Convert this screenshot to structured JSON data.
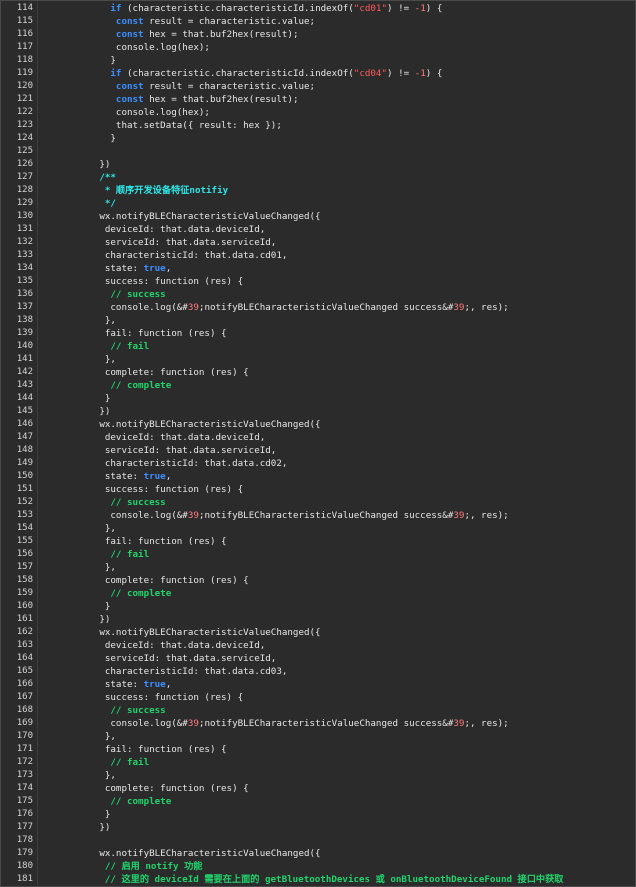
{
  "editor": {
    "lines": [
      {
        "n": "114",
        "t": [
          [
            "            ",
            ""
          ],
          [
            "if",
            "kw"
          ],
          [
            " (characteristic.characteristicId.indexOf(",
            ""
          ],
          [
            "\"cd01\"",
            "str"
          ],
          [
            ") != ",
            ""
          ],
          [
            "-1",
            "num"
          ],
          [
            ") {",
            ""
          ]
        ]
      },
      {
        "n": "115",
        "t": [
          [
            "             ",
            ""
          ],
          [
            "const",
            "kw"
          ],
          [
            " result = characteristic.value;",
            ""
          ]
        ]
      },
      {
        "n": "116",
        "t": [
          [
            "             ",
            ""
          ],
          [
            "const",
            "kw"
          ],
          [
            " hex = that.buf2hex(result);",
            ""
          ]
        ]
      },
      {
        "n": "117",
        "t": [
          [
            "             console.log(hex);",
            ""
          ]
        ]
      },
      {
        "n": "118",
        "t": [
          [
            "            }",
            ""
          ]
        ]
      },
      {
        "n": "119",
        "t": [
          [
            "            ",
            ""
          ],
          [
            "if",
            "kw"
          ],
          [
            " (characteristic.characteristicId.indexOf(",
            ""
          ],
          [
            "\"cd04\"",
            "str"
          ],
          [
            ") != ",
            ""
          ],
          [
            "-1",
            "num"
          ],
          [
            ") {",
            ""
          ]
        ]
      },
      {
        "n": "120",
        "t": [
          [
            "             ",
            ""
          ],
          [
            "const",
            "kw"
          ],
          [
            " result = characteristic.value;",
            ""
          ]
        ]
      },
      {
        "n": "121",
        "t": [
          [
            "             ",
            ""
          ],
          [
            "const",
            "kw"
          ],
          [
            " hex = that.buf2hex(result);",
            ""
          ]
        ]
      },
      {
        "n": "122",
        "t": [
          [
            "             console.log(hex);",
            ""
          ]
        ]
      },
      {
        "n": "123",
        "t": [
          [
            "             that.setData({ result: hex });",
            ""
          ]
        ]
      },
      {
        "n": "124",
        "t": [
          [
            "            }",
            ""
          ]
        ]
      },
      {
        "n": "125",
        "t": [
          [
            "",
            ""
          ]
        ]
      },
      {
        "n": "126",
        "t": [
          [
            "          })",
            ""
          ]
        ]
      },
      {
        "n": "127",
        "t": [
          [
            "          /**",
            "doc"
          ]
        ]
      },
      {
        "n": "128",
        "t": [
          [
            "           * 顺序开发设备特征notifiy",
            "doc"
          ]
        ]
      },
      {
        "n": "129",
        "t": [
          [
            "           */",
            "doc"
          ]
        ]
      },
      {
        "n": "130",
        "t": [
          [
            "          wx.notifyBLECharacteristicValueChanged({",
            ""
          ]
        ]
      },
      {
        "n": "131",
        "t": [
          [
            "           deviceId: that.data.deviceId,",
            ""
          ]
        ]
      },
      {
        "n": "132",
        "t": [
          [
            "           serviceId: that.data.serviceId,",
            ""
          ]
        ]
      },
      {
        "n": "133",
        "t": [
          [
            "           characteristicId: that.data.cd01,",
            ""
          ]
        ]
      },
      {
        "n": "134",
        "t": [
          [
            "           state: ",
            ""
          ],
          [
            "true",
            "kw"
          ],
          [
            ",",
            ""
          ]
        ]
      },
      {
        "n": "135",
        "t": [
          [
            "           success: function (res) {",
            ""
          ]
        ]
      },
      {
        "n": "136",
        "t": [
          [
            "            // success",
            "cm"
          ]
        ]
      },
      {
        "n": "137",
        "t": [
          [
            "            console.log(&#",
            ""
          ],
          [
            "39",
            "num"
          ],
          [
            ";notifyBLECharacteristicValueChanged success&#",
            ""
          ],
          [
            "39",
            "num"
          ],
          [
            ";, res);",
            ""
          ]
        ]
      },
      {
        "n": "138",
        "t": [
          [
            "           },",
            ""
          ]
        ]
      },
      {
        "n": "139",
        "t": [
          [
            "           fail: function (res) {",
            ""
          ]
        ]
      },
      {
        "n": "140",
        "t": [
          [
            "            // fail",
            "cm"
          ]
        ]
      },
      {
        "n": "141",
        "t": [
          [
            "           },",
            ""
          ]
        ]
      },
      {
        "n": "142",
        "t": [
          [
            "           complete: function (res) {",
            ""
          ]
        ]
      },
      {
        "n": "143",
        "t": [
          [
            "            // complete",
            "cm"
          ]
        ]
      },
      {
        "n": "144",
        "t": [
          [
            "           }",
            ""
          ]
        ]
      },
      {
        "n": "145",
        "t": [
          [
            "          })",
            ""
          ]
        ]
      },
      {
        "n": "146",
        "t": [
          [
            "          wx.notifyBLECharacteristicValueChanged({",
            ""
          ]
        ]
      },
      {
        "n": "147",
        "t": [
          [
            "           deviceId: that.data.deviceId,",
            ""
          ]
        ]
      },
      {
        "n": "148",
        "t": [
          [
            "           serviceId: that.data.serviceId,",
            ""
          ]
        ]
      },
      {
        "n": "149",
        "t": [
          [
            "           characteristicId: that.data.cd02,",
            ""
          ]
        ]
      },
      {
        "n": "150",
        "t": [
          [
            "           state: ",
            ""
          ],
          [
            "true",
            "kw"
          ],
          [
            ",",
            ""
          ]
        ]
      },
      {
        "n": "151",
        "t": [
          [
            "           success: function (res) {",
            ""
          ]
        ]
      },
      {
        "n": "152",
        "t": [
          [
            "            // success",
            "cm"
          ]
        ]
      },
      {
        "n": "153",
        "t": [
          [
            "            console.log(&#",
            ""
          ],
          [
            "39",
            "num"
          ],
          [
            ";notifyBLECharacteristicValueChanged success&#",
            ""
          ],
          [
            "39",
            "num"
          ],
          [
            ";, res);",
            ""
          ]
        ]
      },
      {
        "n": "154",
        "t": [
          [
            "           },",
            ""
          ]
        ]
      },
      {
        "n": "155",
        "t": [
          [
            "           fail: function (res) {",
            ""
          ]
        ]
      },
      {
        "n": "156",
        "t": [
          [
            "            // fail",
            "cm"
          ]
        ]
      },
      {
        "n": "157",
        "t": [
          [
            "           },",
            ""
          ]
        ]
      },
      {
        "n": "158",
        "t": [
          [
            "           complete: function (res) {",
            ""
          ]
        ]
      },
      {
        "n": "159",
        "t": [
          [
            "            // complete",
            "cm"
          ]
        ]
      },
      {
        "n": "160",
        "t": [
          [
            "           }",
            ""
          ]
        ]
      },
      {
        "n": "161",
        "t": [
          [
            "          })",
            ""
          ]
        ]
      },
      {
        "n": "162",
        "t": [
          [
            "          wx.notifyBLECharacteristicValueChanged({",
            ""
          ]
        ]
      },
      {
        "n": "163",
        "t": [
          [
            "           deviceId: that.data.deviceId,",
            ""
          ]
        ]
      },
      {
        "n": "164",
        "t": [
          [
            "           serviceId: that.data.serviceId,",
            ""
          ]
        ]
      },
      {
        "n": "165",
        "t": [
          [
            "           characteristicId: that.data.cd03,",
            ""
          ]
        ]
      },
      {
        "n": "166",
        "t": [
          [
            "           state: ",
            ""
          ],
          [
            "true",
            "kw"
          ],
          [
            ",",
            ""
          ]
        ]
      },
      {
        "n": "167",
        "t": [
          [
            "           success: function (res) {",
            ""
          ]
        ]
      },
      {
        "n": "168",
        "t": [
          [
            "            // success",
            "cm"
          ]
        ]
      },
      {
        "n": "169",
        "t": [
          [
            "            console.log(&#",
            ""
          ],
          [
            "39",
            "num"
          ],
          [
            ";notifyBLECharacteristicValueChanged success&#",
            ""
          ],
          [
            "39",
            "num"
          ],
          [
            ";, res);",
            ""
          ]
        ]
      },
      {
        "n": "170",
        "t": [
          [
            "           },",
            ""
          ]
        ]
      },
      {
        "n": "171",
        "t": [
          [
            "           fail: function (res) {",
            ""
          ]
        ]
      },
      {
        "n": "172",
        "t": [
          [
            "            // fail",
            "cm"
          ]
        ]
      },
      {
        "n": "173",
        "t": [
          [
            "           },",
            ""
          ]
        ]
      },
      {
        "n": "174",
        "t": [
          [
            "           complete: function (res) {",
            ""
          ]
        ]
      },
      {
        "n": "175",
        "t": [
          [
            "            // complete",
            "cm"
          ]
        ]
      },
      {
        "n": "176",
        "t": [
          [
            "           }",
            ""
          ]
        ]
      },
      {
        "n": "177",
        "t": [
          [
            "          })",
            ""
          ]
        ]
      },
      {
        "n": "178",
        "t": [
          [
            "",
            ""
          ]
        ]
      },
      {
        "n": "179",
        "t": [
          [
            "          wx.notifyBLECharacteristicValueChanged({",
            ""
          ]
        ]
      },
      {
        "n": "180",
        "t": [
          [
            "           // 启用 notify 功能",
            "cm"
          ]
        ]
      },
      {
        "n": "181",
        "t": [
          [
            "           // 这里的 deviceId 需要在上面的 getBluetoothDevices 或 onBluetoothDeviceFound 接口中获取",
            "cm"
          ]
        ]
      }
    ]
  }
}
